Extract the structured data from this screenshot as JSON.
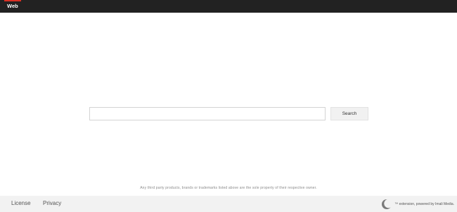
{
  "nav": {
    "tab_label": "Web",
    "accent_color": "#d93025",
    "bar_color": "#222222"
  },
  "search": {
    "value": "",
    "placeholder": "",
    "button_label": "Search"
  },
  "disclaimer": "Any third party products, brands or trademarks listed above are the sole property of their respective owner.",
  "footer": {
    "license_label": "License",
    "privacy_label": "Privacy",
    "credit_text": "™ extension, powered by Imali Media.",
    "logo_icon": "crescent-moon-icon"
  }
}
